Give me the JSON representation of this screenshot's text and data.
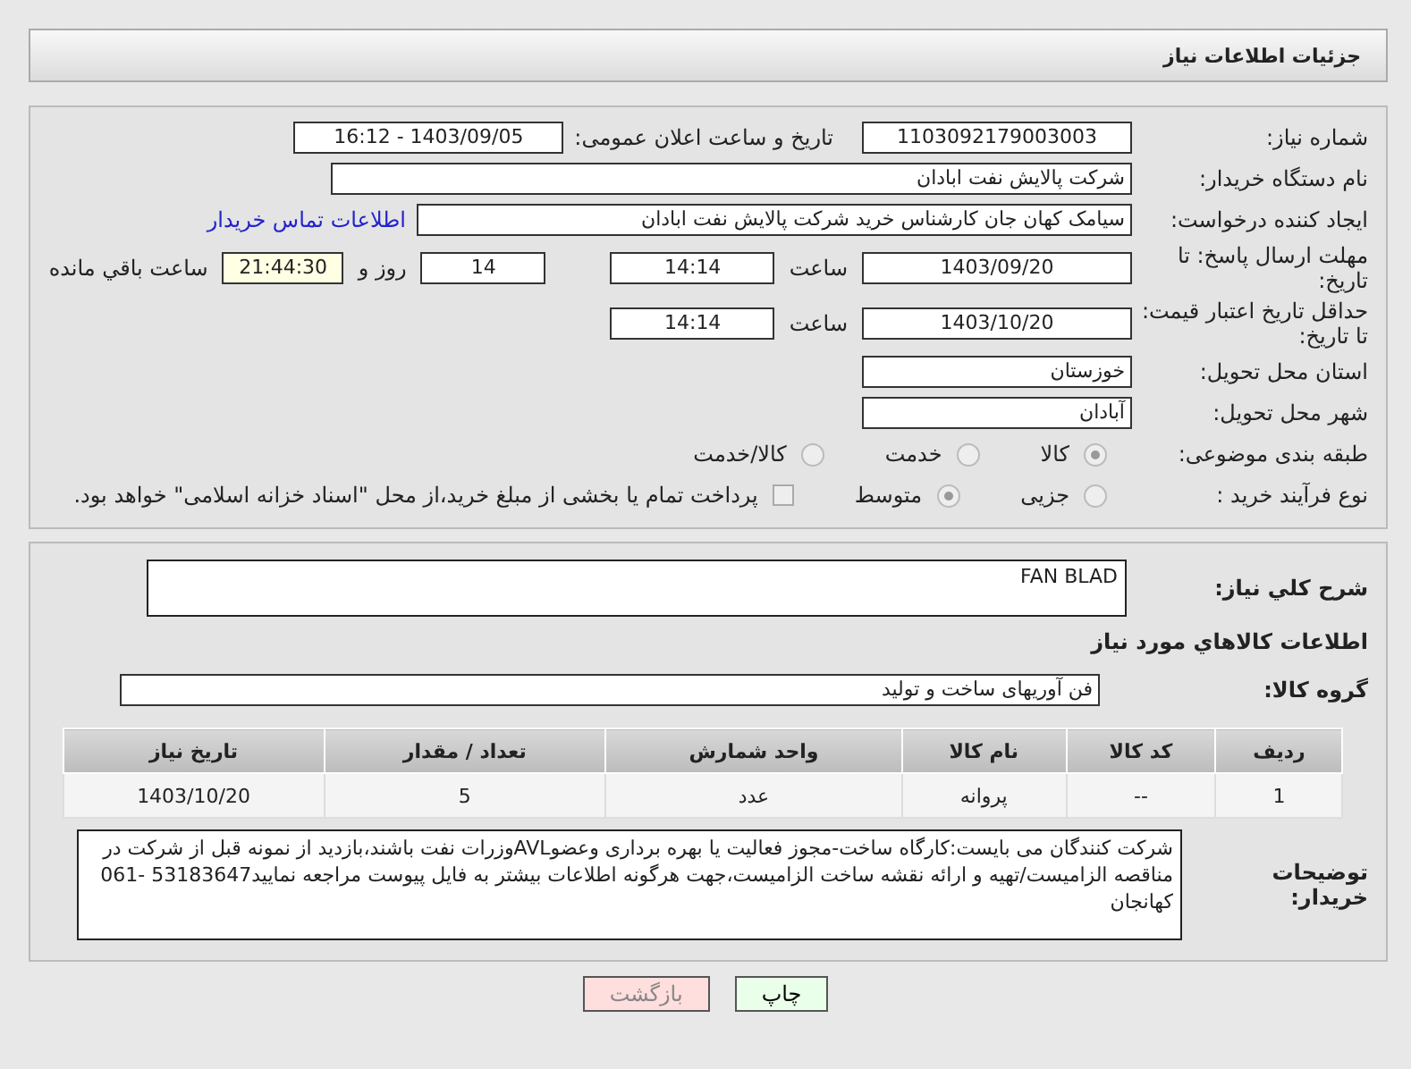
{
  "header": {
    "title": "جزئیات اطلاعات نیاز"
  },
  "need_number": {
    "label": "شماره نیاز:",
    "value": "1103092179003003"
  },
  "announce": {
    "label": "تاریخ و ساعت اعلان عمومی:",
    "value": "1403/09/05 - 16:12"
  },
  "buyer": {
    "label": "نام دستگاه خریدار:",
    "value": "شرکت پالایش نفت ابادان"
  },
  "requester": {
    "label": "ایجاد کننده درخواست:",
    "value": "سیامک کهان جان کارشناس خرید شرکت پالایش نفت ابادان",
    "link": "اطلاعات تماس خریدار"
  },
  "deadline": {
    "label": "مهلت ارسال پاسخ: تا تاریخ:",
    "date": "1403/09/20",
    "time_label": "ساعت",
    "time": "14:14",
    "days": "14",
    "days_label": "روز و",
    "remaining": "21:44:30",
    "remaining_label": "ساعت باقي مانده"
  },
  "validity": {
    "label": "حداقل تاریخ اعتبار قیمت: تا تاریخ:",
    "date": "1403/10/20",
    "time_label": "ساعت",
    "time": "14:14"
  },
  "province": {
    "label": "استان محل تحویل:",
    "value": "خوزستان"
  },
  "city": {
    "label": "شهر محل تحویل:",
    "value": "آبادان"
  },
  "category": {
    "label": "طبقه بندی موضوعی:",
    "options": [
      {
        "label": "کالا",
        "selected": true
      },
      {
        "label": "خدمت",
        "selected": false
      },
      {
        "label": "کالا/خدمت",
        "selected": false
      }
    ]
  },
  "process": {
    "label": "نوع فرآیند خرید :",
    "options": [
      {
        "label": "جزیی",
        "selected": false
      },
      {
        "label": "متوسط",
        "selected": true
      }
    ],
    "payment": {
      "checked": false,
      "text": "پرداخت تمام یا بخشی از مبلغ خرید،از محل \"اسناد خزانه اسلامی\" خواهد بود."
    }
  },
  "description": {
    "label": "شرح کلي نياز:",
    "value": "FAN BLAD"
  },
  "goods_heading": "اطلاعات کالاهاي مورد نياز",
  "goods_group": {
    "label": "گروه کالا:",
    "value": "فن آوریهای ساخت و تولید"
  },
  "table": {
    "columns": [
      "ردیف",
      "کد کالا",
      "نام کالا",
      "واحد شمارش",
      "تعداد / مقدار",
      "تاریخ نیاز"
    ],
    "rows": [
      [
        "1",
        "--",
        "پروانه",
        "عدد",
        "5",
        "1403/10/20"
      ]
    ]
  },
  "buyer_notes": {
    "label": "توضیحات خریدار:",
    "value": "شرکت کنندگان می بایست:کارگاه ساخت-مجوز فعالیت یا بهره برداری وعضوAVLوزرات نفت باشند،بازدید از نمونه قبل از شرکت در مناقصه الزامیست/تهیه و ارائه نقشه ساخت الزامیست،جهت هرگونه اطلاعات بیشتر به فایل پیوست مراجعه نمایید53183647 -061 کهانجان"
  },
  "buttons": [
    {
      "label": "چاپ",
      "kind": "print"
    },
    {
      "label": "بازگشت",
      "kind": "back"
    }
  ]
}
